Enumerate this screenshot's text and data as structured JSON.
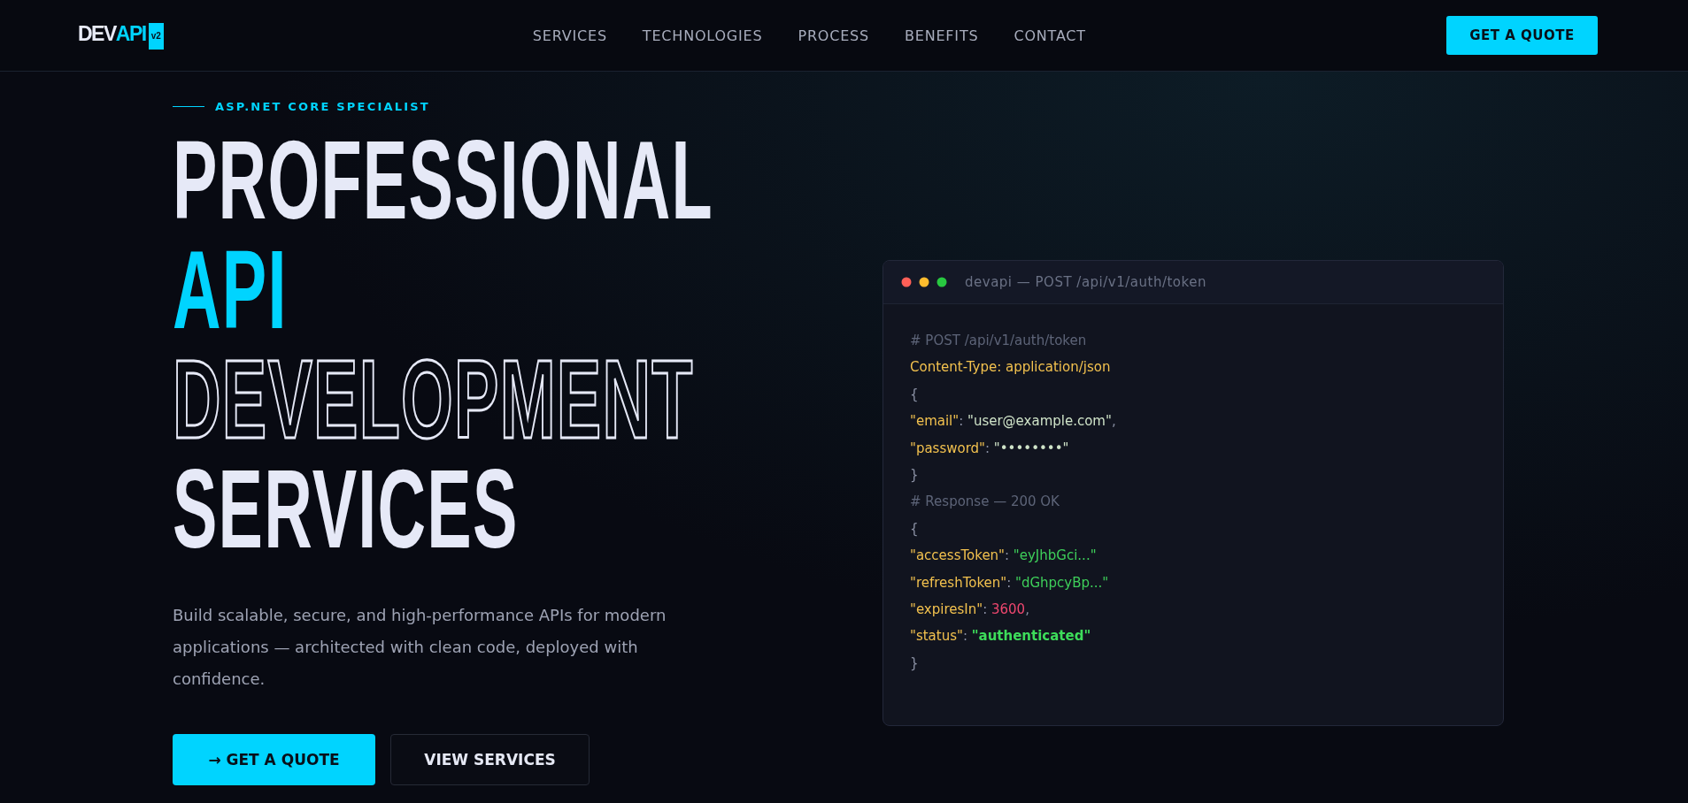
{
  "nav": {
    "logo": {
      "part_1": "DEV",
      "part_2": "API",
      "badge": "v2"
    },
    "links": [
      {
        "label": "SERVICES"
      },
      {
        "label": "TECHNOLOGIES"
      },
      {
        "label": "PROCESS"
      },
      {
        "label": "BENEFITS"
      },
      {
        "label": "CONTACT"
      }
    ],
    "cta": "GET A QUOTE"
  },
  "hero": {
    "eyebrow": "ASP.NET CORE SPECIALIST",
    "headline": [
      {
        "text": "PROFESSIONAL",
        "kind": "solid"
      },
      {
        "text": "API",
        "kind": "accent"
      },
      {
        "text": "DEVELOPMENT",
        "kind": "outline"
      },
      {
        "text": "SERVICES",
        "kind": "solid"
      }
    ],
    "description": "Build scalable, secure, and high-performance APIs for modern applications — architected with clean code, deployed with confidence.",
    "buttons": [
      {
        "label": "→ GET A QUOTE",
        "kind": "primary"
      },
      {
        "label": "VIEW SERVICES",
        "kind": "secondary"
      }
    ]
  },
  "code_window": {
    "title": "devapi — POST /api/v1/auth/token",
    "lines": [
      [
        {
          "text": "# POST /api/v1/auth/token",
          "kind": "comment"
        }
      ],
      [
        {
          "text": "Content-Type: application/json",
          "kind": "header"
        }
      ],
      [
        {
          "text": "{",
          "kind": "punct"
        }
      ],
      [
        {
          "text": "\"email\"",
          "kind": "key"
        },
        {
          "text": ": ",
          "kind": "punct"
        },
        {
          "text": "\"user@example.com\"",
          "kind": "plain"
        },
        {
          "text": ",",
          "kind": "punct"
        }
      ],
      [
        {
          "text": "\"password\"",
          "kind": "key"
        },
        {
          "text": ": ",
          "kind": "punct"
        },
        {
          "text": "\"••••••••\"",
          "kind": "plain"
        }
      ],
      [
        {
          "text": "}",
          "kind": "punct"
        }
      ],
      [
        {
          "text": "# Response — 200 OK",
          "kind": "comment"
        }
      ],
      [
        {
          "text": "{",
          "kind": "punct"
        }
      ],
      [
        {
          "text": "\"accessToken\"",
          "kind": "key"
        },
        {
          "text": ": ",
          "kind": "punct"
        },
        {
          "text": "\"eyJhbGci...\"",
          "kind": "string"
        }
      ],
      [
        {
          "text": "\"refreshToken\"",
          "kind": "key"
        },
        {
          "text": ": ",
          "kind": "punct"
        },
        {
          "text": "\"dGhpcyBp...\"",
          "kind": "string"
        }
      ],
      [
        {
          "text": "\"expiresIn\"",
          "kind": "key"
        },
        {
          "text": ": ",
          "kind": "punct"
        },
        {
          "text": "3600",
          "kind": "number"
        },
        {
          "text": ",",
          "kind": "punct"
        }
      ],
      [
        {
          "text": "\"status\"",
          "kind": "key"
        },
        {
          "text": ": ",
          "kind": "punct"
        },
        {
          "text": "\"authenticated\"",
          "kind": "status"
        }
      ],
      [
        {
          "text": "}",
          "kind": "punct"
        }
      ]
    ]
  }
}
